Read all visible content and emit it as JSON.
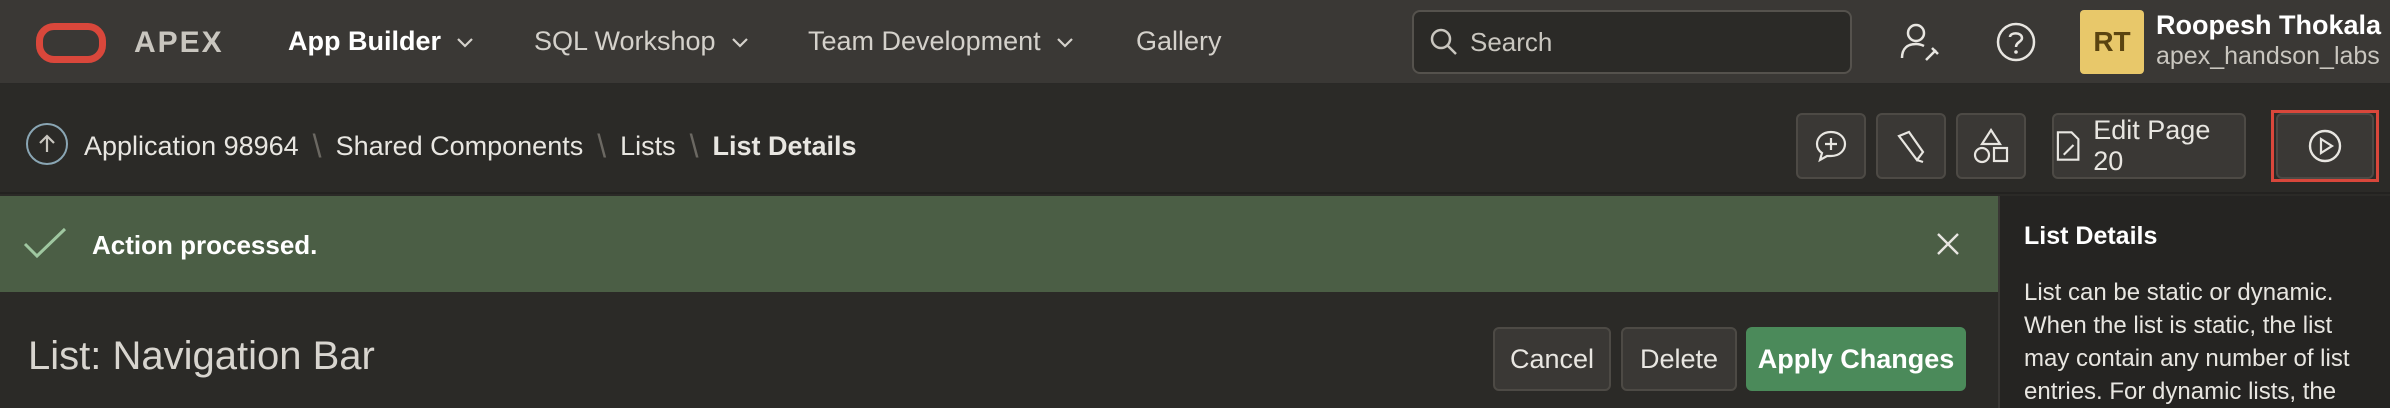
{
  "topbar": {
    "brand": "APEX",
    "nav": [
      {
        "label": "App Builder",
        "active": true
      },
      {
        "label": "SQL Workshop"
      },
      {
        "label": "Team Development"
      },
      {
        "label": "Gallery"
      }
    ],
    "search_placeholder": "Search",
    "user": {
      "initials": "RT",
      "name": "Roopesh Thokala",
      "workspace": "apex_handson_labs"
    },
    "icons": [
      "administration-icon",
      "help-icon"
    ]
  },
  "breadcrumb": {
    "items": [
      "Application 98964",
      "Shared Components",
      "Lists"
    ],
    "current": "List Details"
  },
  "toolbar": {
    "edit_page_label": "Edit Page 20",
    "icons": [
      "feedback-icon",
      "developer-comments-icon",
      "shared-components-icon",
      "run-icon"
    ]
  },
  "message": {
    "text": "Action processed."
  },
  "main": {
    "title": "List: Navigation Bar",
    "buttons": {
      "cancel": "Cancel",
      "delete": "Delete",
      "apply": "Apply Changes"
    }
  },
  "help": {
    "title": "List Details",
    "text": "List can be static or dynamic. When the list is static, the list may contain any number of list entries. For dynamic lists, the"
  },
  "colors": {
    "accent": "#d9473b",
    "success_bg": "#4b5e45",
    "primary_button": "#4b8a5a"
  }
}
